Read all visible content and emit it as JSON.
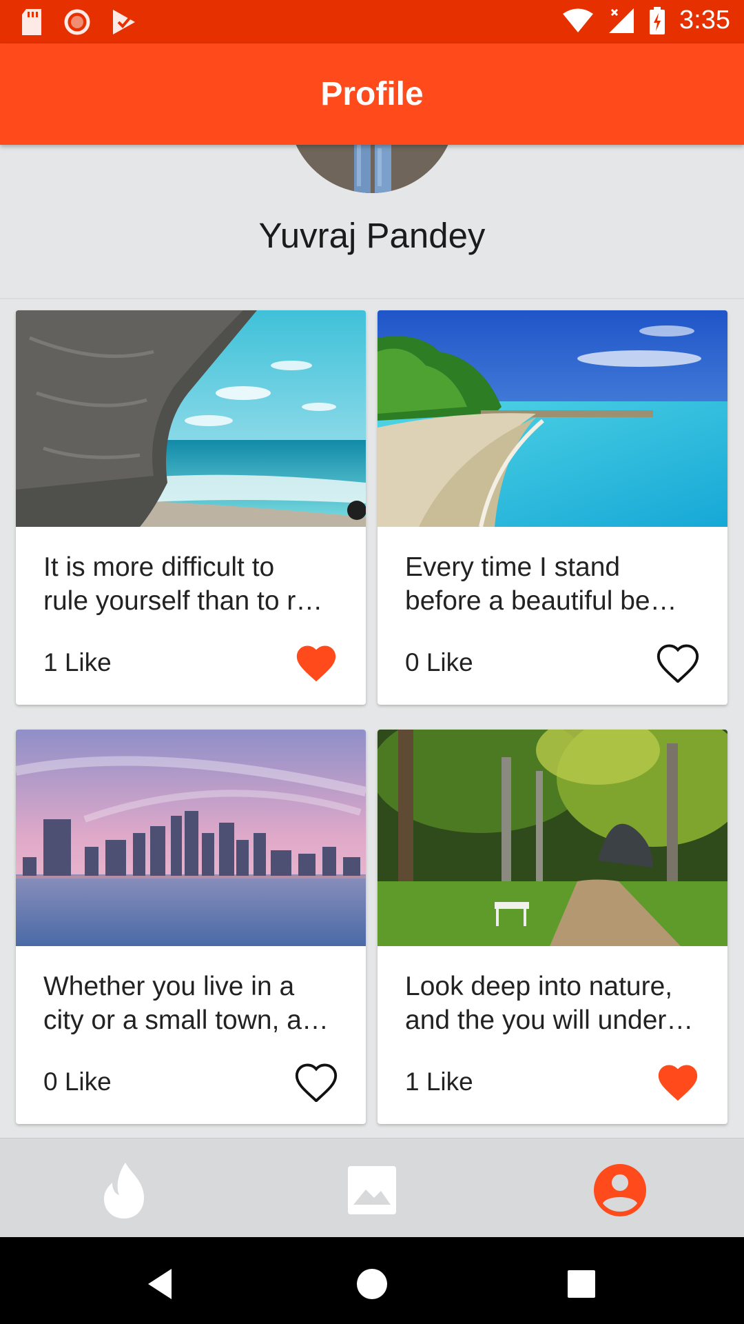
{
  "status_bar": {
    "time": "3:35",
    "left_icons": [
      "sd-card-icon",
      "record-icon",
      "play-store-icon"
    ],
    "right_icons": [
      "wifi-icon",
      "signal-icon",
      "battery-charging-icon"
    ]
  },
  "app_bar": {
    "title": "Profile"
  },
  "profile": {
    "name": "Yuvraj Pandey",
    "avatar_icon": "avatar-photo"
  },
  "posts": [
    {
      "text_line1": "It is more difficult to",
      "text_line2": "rule yourself than to r…",
      "likes": "1 Like",
      "liked": true,
      "image": "sea-cave-beach"
    },
    {
      "text_line1": "Every time I stand",
      "text_line2": "before a beautiful be…",
      "likes": "0 Like",
      "liked": false,
      "image": "tropical-beach"
    },
    {
      "text_line1": "Whether you live in a",
      "text_line2": "city or a small town, a…",
      "likes": "0 Like",
      "liked": false,
      "image": "city-skyline"
    },
    {
      "text_line1": "Look deep into nature,",
      "text_line2": "and the you will under…",
      "likes": "1 Like",
      "liked": true,
      "image": "forest-path"
    }
  ],
  "bottom_nav": {
    "items": [
      {
        "icon": "flame-icon",
        "active": false
      },
      {
        "icon": "image-icon",
        "active": false
      },
      {
        "icon": "account-circle-icon",
        "active": true
      }
    ]
  },
  "colors": {
    "accent": "#ff4a1c",
    "status_bar": "#e63000",
    "liked": "#ff4a1c"
  }
}
